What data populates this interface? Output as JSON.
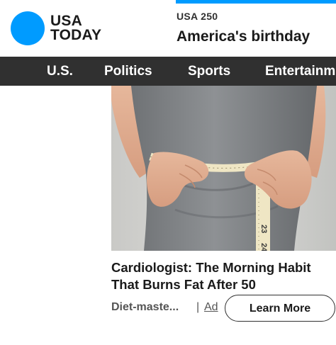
{
  "brand": {
    "line1": "USA",
    "line2": "TODAY",
    "accent_color": "#009bff"
  },
  "promo": {
    "eyebrow": "USA 250",
    "title": "America's birthday"
  },
  "nav": {
    "items": [
      {
        "label": "U.S."
      },
      {
        "label": "Politics"
      },
      {
        "label": "Sports"
      },
      {
        "label": "Entertainment"
      }
    ],
    "background": "#303030"
  },
  "ad": {
    "image_subject": "person measuring waist with tape measure",
    "tape_numbers": [
      "23",
      "24"
    ],
    "headline": "Cardiologist: The Morning Habit That Burns Fat After 50",
    "source": "Diet-maste...",
    "separator": "|",
    "ad_label": "Ad",
    "cta_label": "Learn More"
  }
}
